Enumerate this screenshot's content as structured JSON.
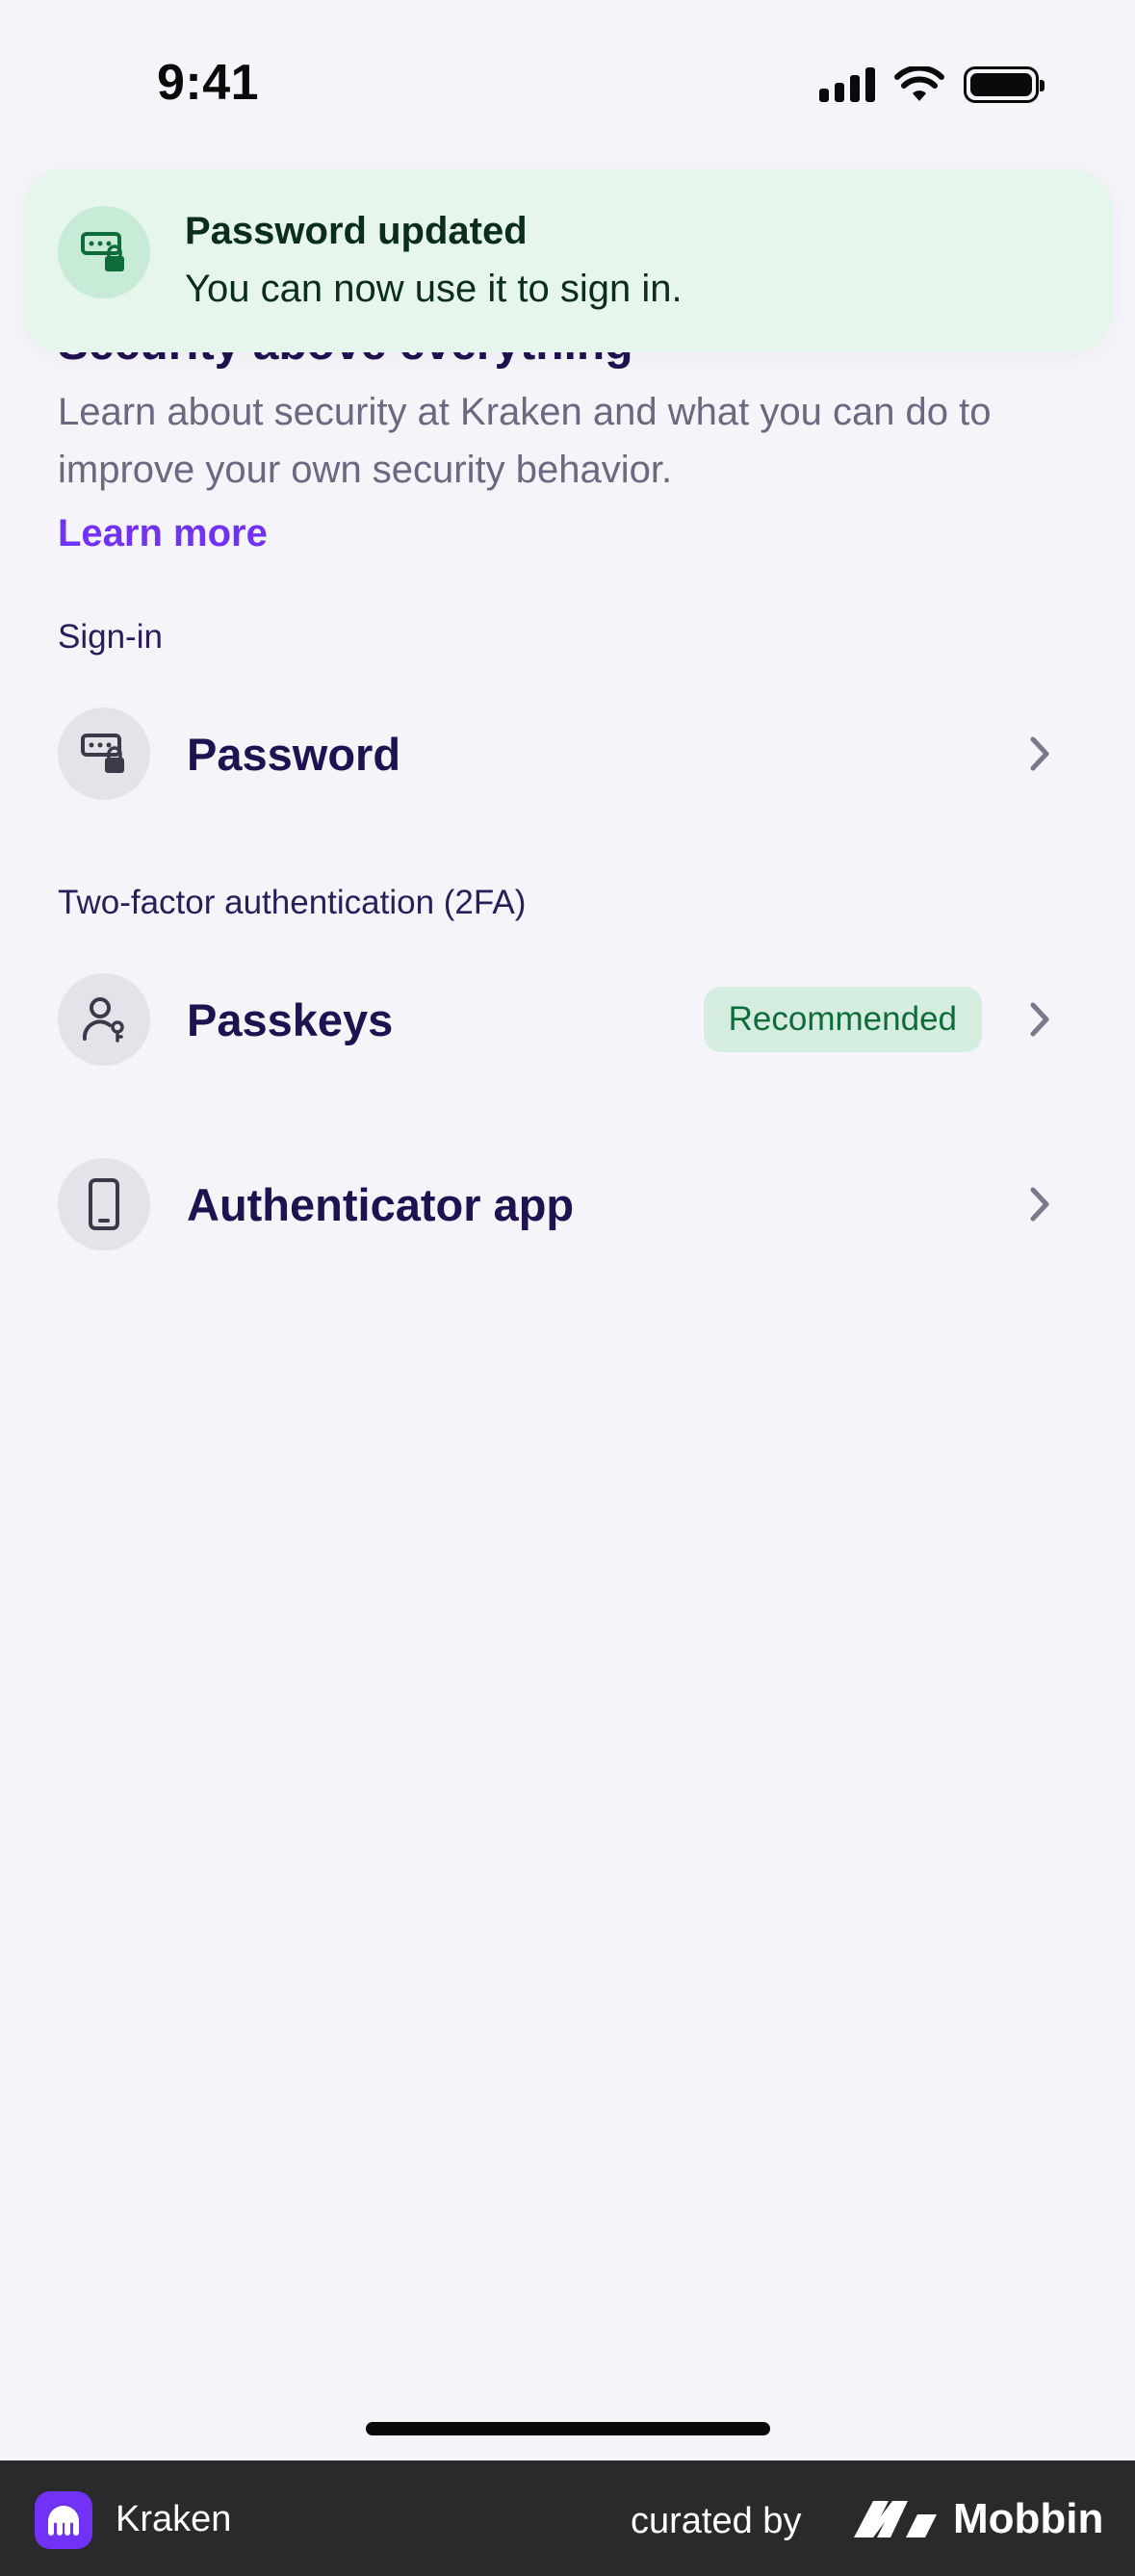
{
  "status_bar": {
    "time": "9:41"
  },
  "toast": {
    "title": "Password updated",
    "message": "You can now use it to sign in.",
    "icon": "password-lock-icon"
  },
  "intro": {
    "heading": "Security above everything",
    "description": "Learn about security at Kraken and what you can do to improve your own security behavior.",
    "link": "Learn more"
  },
  "sign_in": {
    "section_label": "Sign-in",
    "items": [
      {
        "label": "Password",
        "icon": "password-lock-icon"
      }
    ]
  },
  "two_factor": {
    "section_label": "Two-factor authentication (2FA)",
    "items": [
      {
        "label": "Passkeys",
        "icon": "user-key-icon",
        "badge": "Recommended"
      },
      {
        "label": "Authenticator app",
        "icon": "phone-icon"
      }
    ]
  },
  "footer": {
    "app_name": "Kraken",
    "curated_by": "curated by",
    "brand": "Mobbin"
  },
  "colors": {
    "accent": "#7132f5",
    "heading": "#1f1250",
    "toast_bg": "#e6f6ec",
    "badge_bg": "#d5ece0",
    "badge_text": "#0e6b3a"
  }
}
